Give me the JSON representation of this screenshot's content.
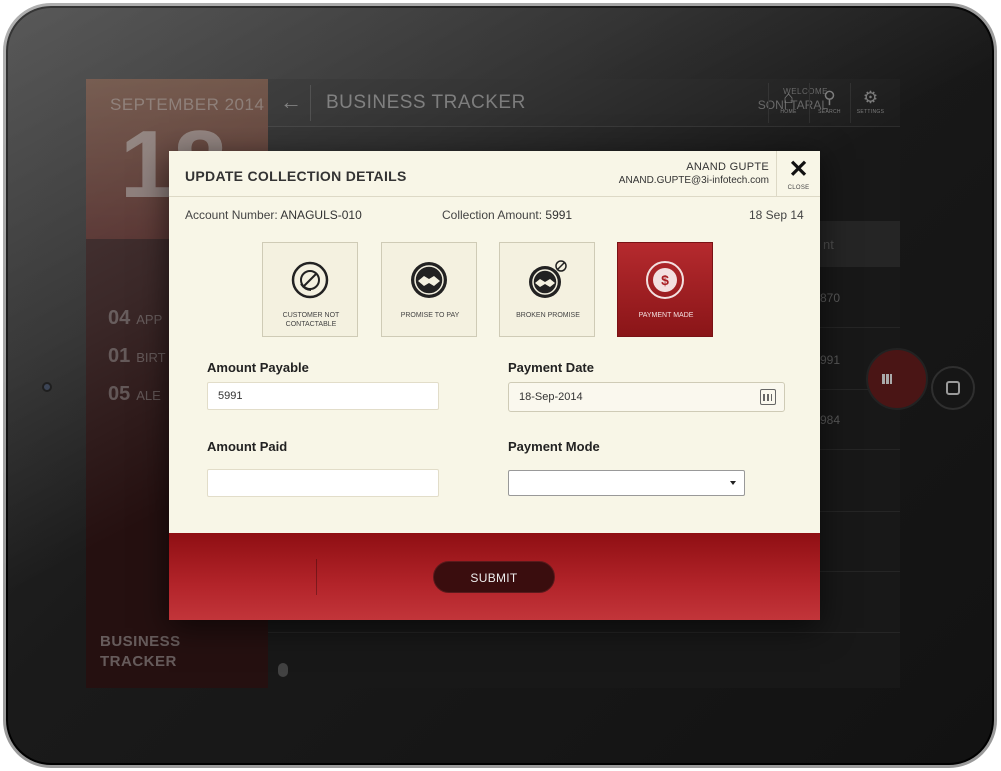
{
  "sidebar": {
    "month": "SEPTEMBER 2014",
    "day": "18",
    "items": [
      {
        "num": "04",
        "label": "APP"
      },
      {
        "num": "01",
        "label": "BIRT"
      },
      {
        "num": "05",
        "label": "ALE"
      }
    ],
    "brand_line1": "BUSINESS",
    "brand_line2": "TRACKER"
  },
  "topbar": {
    "back": "←",
    "title": "BUSINESS TRACKER",
    "welcome_label": "WELCOME",
    "welcome_user": "SONI TARAL",
    "icons": [
      {
        "glyph": "⌂",
        "label": "HOME"
      },
      {
        "glyph": "⚲",
        "label": "SEARCH"
      },
      {
        "glyph": "⚙",
        "label": "SETTINGS"
      }
    ]
  },
  "background_table": {
    "header": "nt",
    "values": [
      "870",
      "991",
      "984"
    ]
  },
  "modal": {
    "title": "UPDATE COLLECTION DETAILS",
    "user_name": "ANAND GUPTE",
    "user_email": "ANAND.GUPTE@3i-infotech.com",
    "close_label": "CLOSE",
    "close_glyph": "✕",
    "account_label": "Account Number:",
    "account_value": "ANAGULS-010",
    "amount_label": "Collection Amount:",
    "amount_value": "5991",
    "date": "18 Sep 14",
    "statuses": [
      {
        "label": "CUSTOMER NOT CONTACTABLE",
        "icon": "phone-blocked-icon",
        "active": false
      },
      {
        "label": "PROMISE TO PAY",
        "icon": "handshake-icon",
        "active": false
      },
      {
        "label": "BROKEN PROMISE",
        "icon": "broken-handshake-icon",
        "active": false
      },
      {
        "label": "PAYMENT MADE",
        "icon": "dollar-coin-icon",
        "active": true
      }
    ],
    "fields": {
      "amount_payable_label": "Amount Payable",
      "amount_payable_value": "5991",
      "payment_date_label": "Payment Date",
      "payment_date_value": "18-Sep-2014",
      "amount_paid_label": "Amount Paid",
      "amount_paid_value": "",
      "payment_mode_label": "Payment Mode",
      "payment_mode_value": ""
    },
    "submit_label": "SUBMIT"
  },
  "colors": {
    "accent_red": "#a81e23",
    "modal_bg": "#f8f6e7"
  }
}
